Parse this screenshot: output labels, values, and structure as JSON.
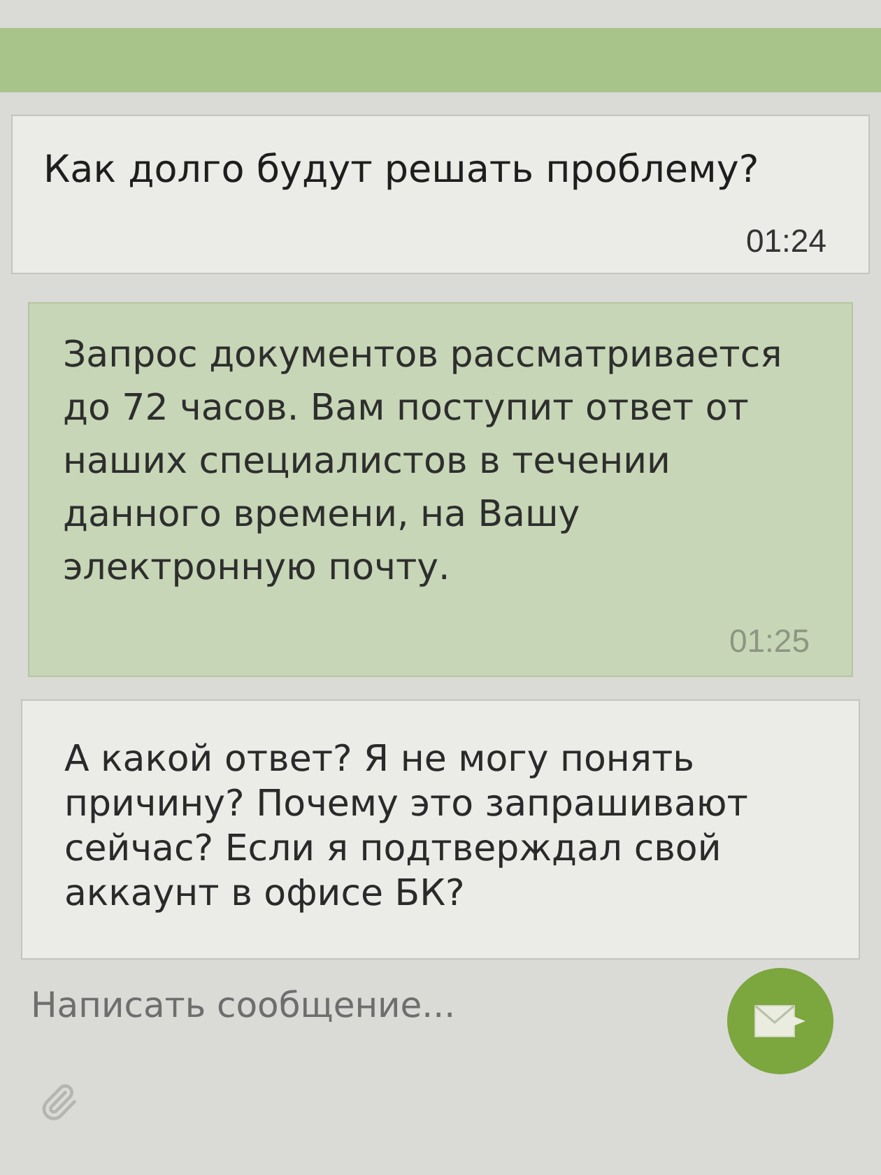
{
  "messages": [
    {
      "kind": "operator"
    },
    {
      "kind": "user",
      "text": "Как долго будут решать проблему?",
      "time": "01:24"
    },
    {
      "kind": "operator",
      "text": "Запрос документов рассматривается до 72 часов. Вам поступит ответ от наших специалистов в течении данного времени, на Вашу электронную почту.",
      "time": "01:25"
    },
    {
      "kind": "user",
      "text": "А какой ответ? Я не могу понять причину? Почему это запрашивают сейчас? Если я подтверждал свой аккаунт в офисе БК?"
    }
  ],
  "composer": {
    "placeholder": "Написать сообщение..."
  }
}
